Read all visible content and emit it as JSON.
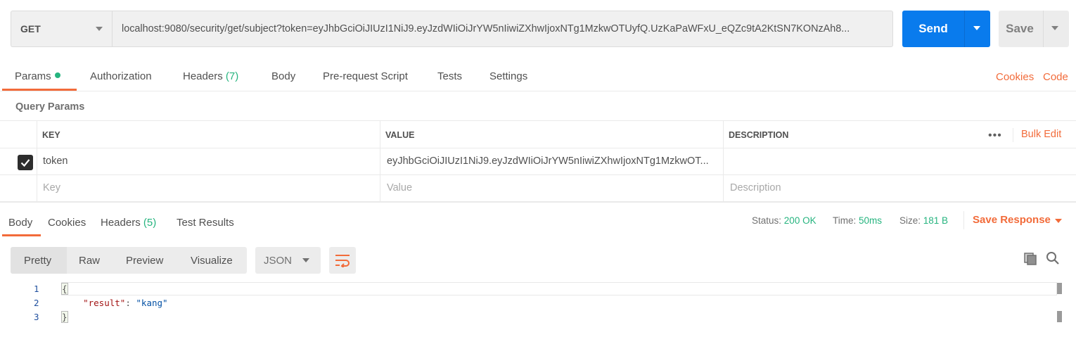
{
  "request": {
    "method": "GET",
    "url": "localhost:9080/security/get/subject?token=eyJhbGciOiJIUzI1NiJ9.eyJzdWIiOiJrYW5nIiwiZXhwIjoxNTg1MzkwOTUyfQ.UzKaPaWFxU_eQZc9tA2KtSN7KONzAh8...",
    "send_label": "Send",
    "save_label": "Save"
  },
  "request_tabs": {
    "params": "Params",
    "authorization": "Authorization",
    "headers": "Headers",
    "headers_count": "(7)",
    "body": "Body",
    "pre_request": "Pre-request Script",
    "tests": "Tests",
    "settings": "Settings",
    "cookies": "Cookies",
    "code": "Code"
  },
  "query_params": {
    "title": "Query Params",
    "columns": {
      "key": "KEY",
      "value": "VALUE",
      "description": "DESCRIPTION"
    },
    "bulk_edit": "Bulk Edit",
    "rows": [
      {
        "key": "token",
        "value": "eyJhbGciOiJIUzI1NiJ9.eyJzdWIiOiJrYW5nIiwiZXhwIjoxNTg1MzkwOT...",
        "description": "",
        "enabled": true
      }
    ],
    "placeholders": {
      "key": "Key",
      "value": "Value",
      "description": "Description"
    }
  },
  "response_tabs": {
    "body": "Body",
    "cookies": "Cookies",
    "headers": "Headers",
    "headers_count": "(5)",
    "test_results": "Test Results"
  },
  "response_status": {
    "status_label": "Status:",
    "status_value": "200 OK",
    "time_label": "Time:",
    "time_value": "50ms",
    "size_label": "Size:",
    "size_value": "181 B",
    "save_response": "Save Response"
  },
  "format_toolbar": {
    "pretty": "Pretty",
    "raw": "Raw",
    "preview": "Preview",
    "visualize": "Visualize",
    "language": "JSON"
  },
  "response_body": {
    "line_numbers": [
      "1",
      "2",
      "3"
    ],
    "open_brace": "{",
    "key": "\"result\"",
    "colon": ": ",
    "value": "\"kang\"",
    "close_brace": "}"
  },
  "colors": {
    "accent_orange": "#f26b3a",
    "send_blue": "#097bed",
    "status_green": "#26b47f"
  },
  "icons": [
    "chevron-down-icon",
    "checkbox-checked-icon",
    "more-dots-icon",
    "wrap-lines-icon",
    "copy-icon",
    "search-icon"
  ]
}
